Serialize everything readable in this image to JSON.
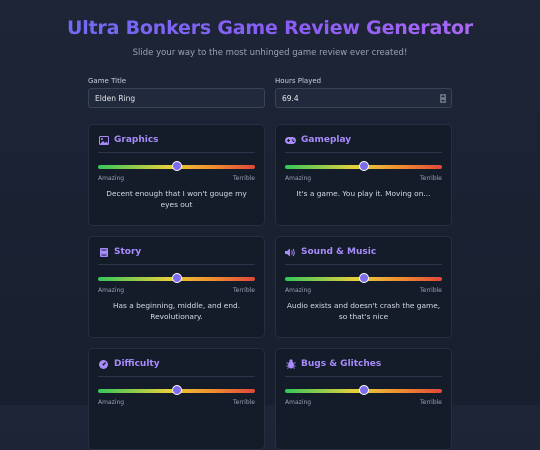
{
  "header": {
    "title": "Ultra Bonkers Game Review Generator",
    "subtitle": "Slide your way to the most unhinged game review ever created!"
  },
  "form": {
    "game_title": {
      "label": "Game Title",
      "value": "Elden Ring"
    },
    "hours_played": {
      "label": "Hours Played",
      "value": "69.4"
    }
  },
  "slider_labels": {
    "left": "Amazing",
    "right": "Terrible"
  },
  "categories": [
    {
      "name": "Graphics",
      "icon": "image-icon",
      "level": 0.5,
      "verdict": "Decent enough that I won't gouge my eyes out"
    },
    {
      "name": "Gameplay",
      "icon": "gamepad-icon",
      "level": 0.5,
      "verdict": "It's a game. You play it. Moving on..."
    },
    {
      "name": "Story",
      "icon": "book-icon",
      "level": 0.5,
      "verdict": "Has a beginning, middle, and end. Revolutionary."
    },
    {
      "name": "Sound & Music",
      "icon": "volume-icon",
      "level": 0.5,
      "verdict": "Audio exists and doesn't crash the game, so that's nice"
    },
    {
      "name": "Difficulty",
      "icon": "gauge-icon",
      "level": 0.5,
      "verdict": ""
    },
    {
      "name": "Bugs & Glitches",
      "icon": "bug-icon",
      "level": 0.5,
      "verdict": ""
    }
  ],
  "colors": {
    "accent": "#8b5cf6",
    "heading": "#a78bfa",
    "background": "#1b2233",
    "card": "#141b29"
  }
}
